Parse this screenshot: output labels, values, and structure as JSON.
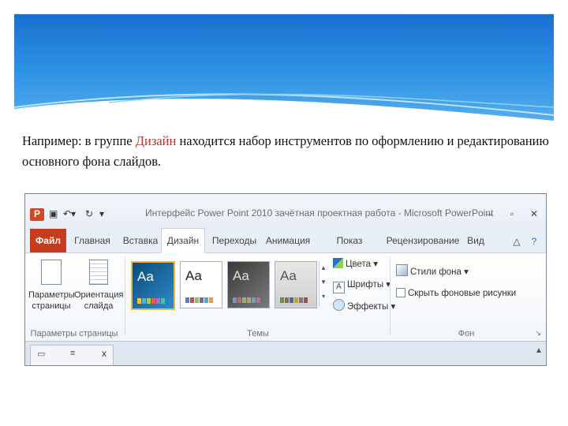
{
  "slide": {
    "text_before": "Например: в группе ",
    "highlight": "Дизайн",
    "text_after": "  находится набор инструментов по оформлению и редактированию основного фона слайдов."
  },
  "app": {
    "window_title": "Интерфейс Power Point 2010  зачётная проектная работа - Microsoft PowerPoint",
    "tabs": [
      "Файл",
      "Главная",
      "Вставка",
      "Дизайн",
      "Переходы",
      "Анимация",
      "Показ слайдов",
      "Рецензирование",
      "Вид"
    ],
    "active_tab": "Дизайн",
    "page_setup": {
      "params_label": "Параметры страницы",
      "orientation_label": "Ориентация слайда",
      "group_label": "Параметры страницы"
    },
    "themes": {
      "aa_label": "Aa",
      "group_label": "Темы"
    },
    "theme_options": {
      "colors": "Цвета",
      "fonts": "Шрифты",
      "effects": "Эффекты"
    },
    "background": {
      "styles": "Стили фона",
      "hide_graphics": "Скрыть фоновые рисунки",
      "group_label": "Фон"
    },
    "bottom_close": "x",
    "colors": {
      "file_tab": "#c73c1c",
      "banner": "#2b8fe3",
      "highlight_text": "#c0302a"
    }
  }
}
